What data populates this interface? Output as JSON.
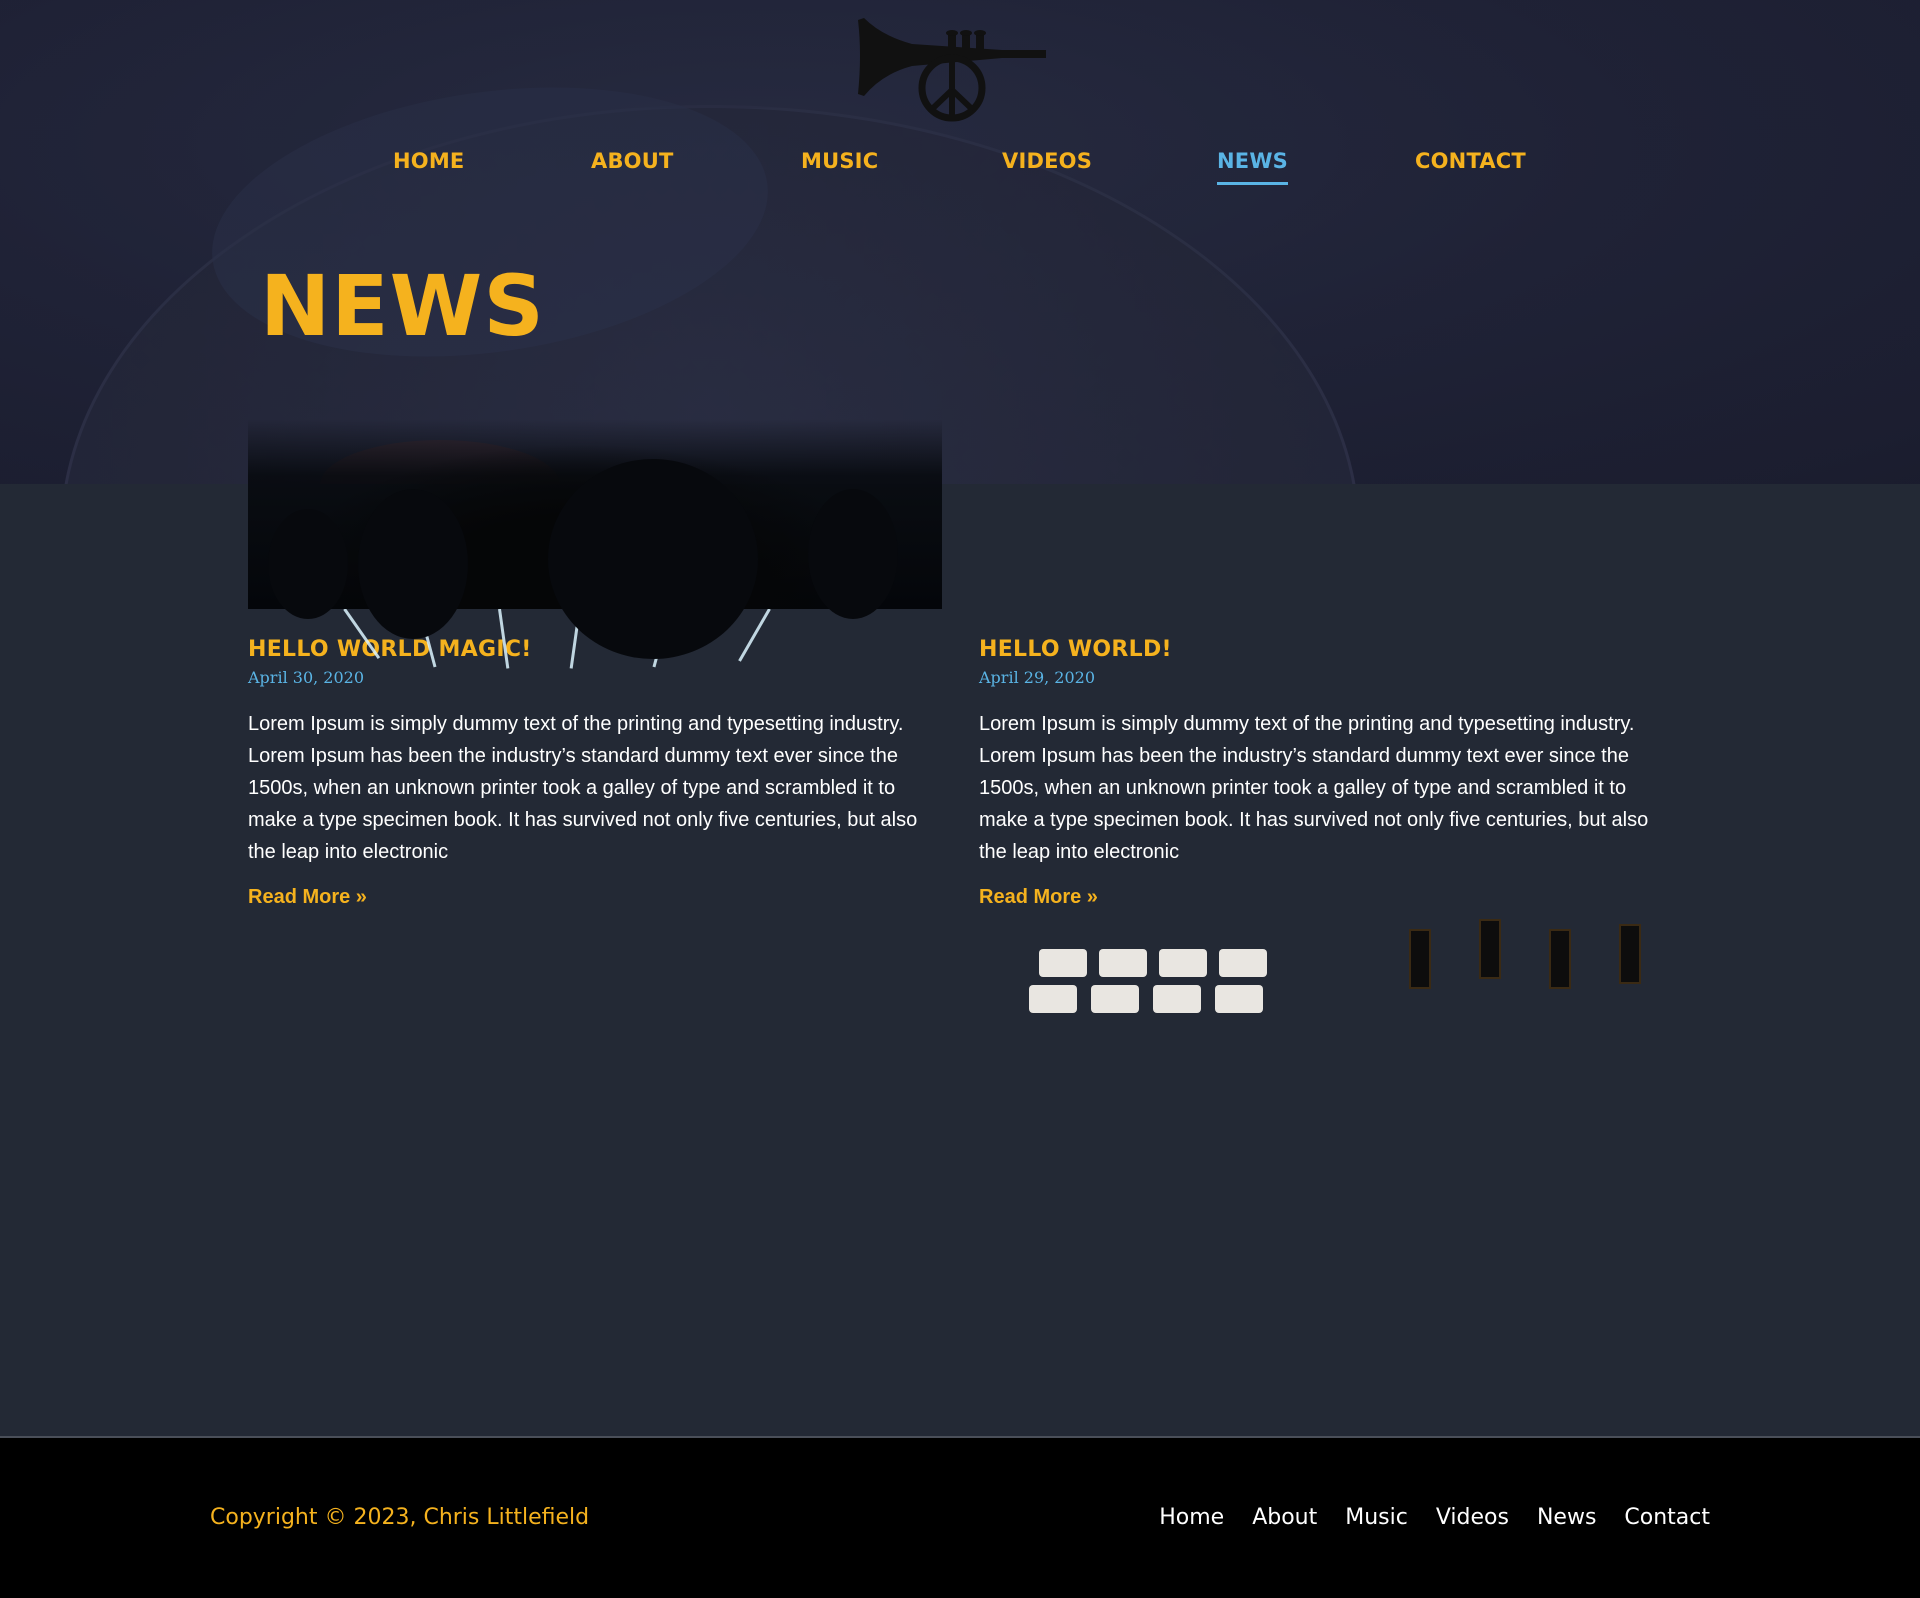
{
  "header": {
    "logo_icon": "trumpet-peace-sign-logo",
    "nav": [
      {
        "label": "HOME",
        "active": false
      },
      {
        "label": "ABOUT",
        "active": false
      },
      {
        "label": "MUSIC",
        "active": false
      },
      {
        "label": "VIDEOS",
        "active": false
      },
      {
        "label": "NEWS",
        "active": true
      },
      {
        "label": "CONTACT",
        "active": false
      }
    ]
  },
  "hero": {
    "title": "NEWS"
  },
  "posts": [
    {
      "image": "concert-stage-lights-crowd",
      "title": "HELLO WORLD MAGIC!",
      "date": "April 30, 2020",
      "excerpt": "Lorem Ipsum is simply dummy text of the printing and typesetting industry. Lorem Ipsum has been the industry’s standard dummy text ever since the 1500s, when an unknown printer took a galley of type and scrambled it to make a type specimen book. It has survived not only five centuries, but also the leap into electronic",
      "read_more": "Read More »"
    },
    {
      "image": "dj-controller-turntable",
      "title": "HELLO WORLD!",
      "date": "April 29, 2020",
      "excerpt": "Lorem Ipsum is simply dummy text of the printing and typesetting industry. Lorem Ipsum has been the industry’s standard dummy text ever since the 1500s, when an unknown printer took a galley of type and scrambled it to make a type specimen book. It has survived not only five centuries, but also the leap into electronic",
      "read_more": "Read More »"
    }
  ],
  "footer": {
    "copyright": "Copyright © 2023, Chris Littlefield",
    "links": [
      "Home",
      "About",
      "Music",
      "Videos",
      "News",
      "Contact"
    ]
  },
  "colors": {
    "accent": "#f5b21e",
    "active_link": "#5ab4e5",
    "body_bg": "#232935",
    "footer_bg": "#000000"
  }
}
